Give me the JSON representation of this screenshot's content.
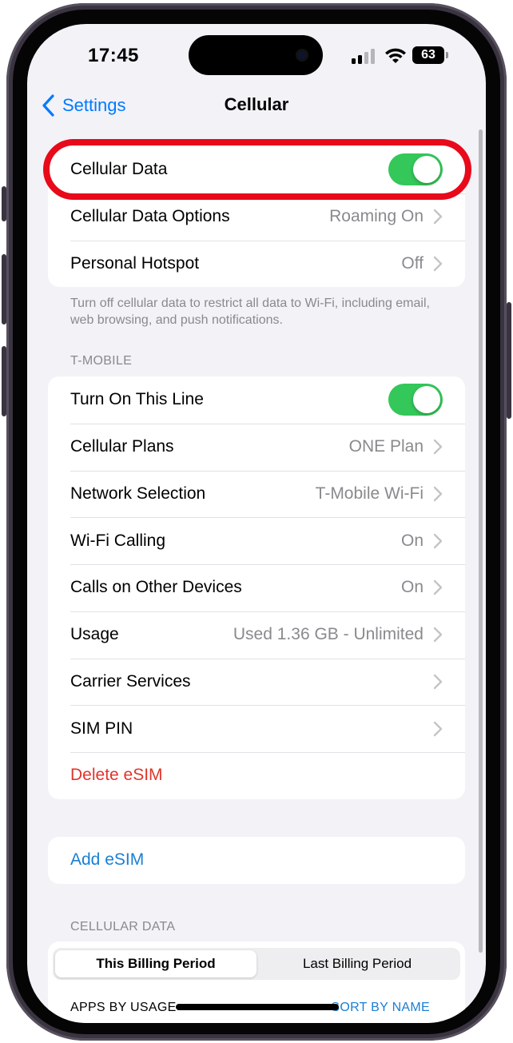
{
  "status_bar": {
    "time": "17:45",
    "battery": "63"
  },
  "nav": {
    "back_label": "Settings",
    "title": "Cellular"
  },
  "group1": {
    "rows": [
      {
        "label": "Cellular Data",
        "toggle": true
      },
      {
        "label": "Cellular Data Options",
        "value": "Roaming On"
      },
      {
        "label": "Personal Hotspot",
        "value": "Off"
      }
    ],
    "footer": "Turn off cellular data to restrict all data to Wi-Fi, including email, web browsing, and push notifications."
  },
  "section_tmobile": {
    "header": "T-MOBILE",
    "rows": [
      {
        "label": "Turn On This Line",
        "toggle": true
      },
      {
        "label": "Cellular Plans",
        "value": "ONE Plan"
      },
      {
        "label": "Network Selection",
        "value": "T-Mobile Wi-Fi"
      },
      {
        "label": "Wi-Fi Calling",
        "value": "On"
      },
      {
        "label": "Calls on Other Devices",
        "value": "On"
      },
      {
        "label": "Usage",
        "value": "Used 1.36 GB - Unlimited"
      },
      {
        "label": "Carrier Services",
        "value": ""
      },
      {
        "label": "SIM PIN",
        "value": ""
      },
      {
        "label": "Delete eSIM"
      }
    ]
  },
  "add_esim": {
    "label": "Add eSIM"
  },
  "cellular_data_section": {
    "header": "CELLULAR DATA",
    "segments": [
      "This Billing Period",
      "Last Billing Period"
    ],
    "active_segment": "This Billing Period",
    "apps_by_usage": "APPS BY USAGE",
    "sort_by_name": "SORT BY NAME"
  },
  "colors": {
    "toggle_on": "#34c759",
    "link": "#1a7fd4",
    "destructive": "#e0352b",
    "highlight": "#e8091a"
  }
}
